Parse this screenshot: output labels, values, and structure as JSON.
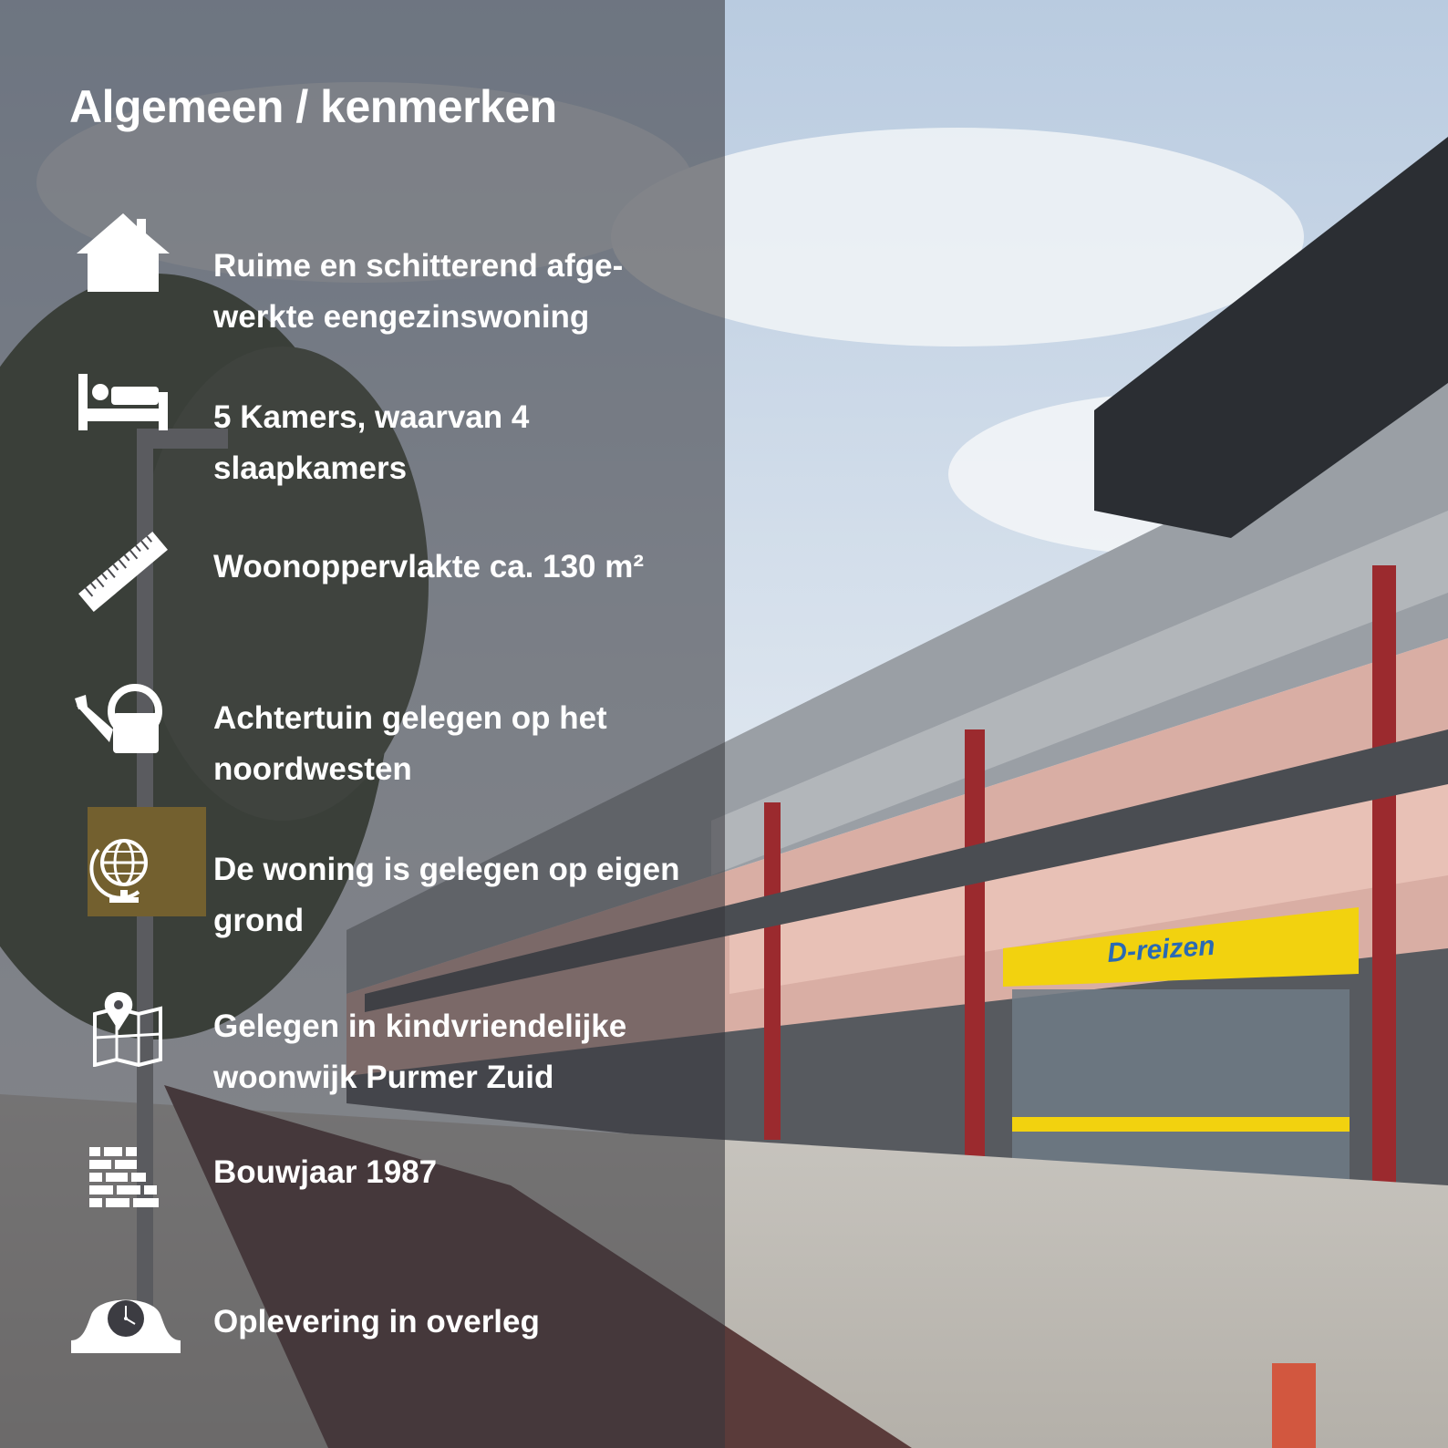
{
  "title": "Algemeen / kenmerken",
  "features": [
    {
      "icon": "house-icon",
      "text": "Ruime en schitterend afge-werkte eengezinswoning"
    },
    {
      "icon": "bed-icon",
      "text": "5 Kamers, waarvan 4 slaapkamers"
    },
    {
      "icon": "ruler-icon",
      "text": "Woonoppervlakte ca. 130 m²"
    },
    {
      "icon": "watering-can-icon",
      "text": "Achtertuin gelegen op het noordwesten"
    },
    {
      "icon": "globe-icon",
      "text": "De woning is gelegen op eigen grond"
    },
    {
      "icon": "map-pin-icon",
      "text": "Gelegen in kindvriendelijke woonwijk Purmer Zuid"
    },
    {
      "icon": "bricks-icon",
      "text": "Bouwjaar 1987"
    },
    {
      "icon": "mantel-clock-icon",
      "text": "Oplevering in overleg"
    }
  ],
  "storefront_sign": "D-reizen",
  "colors": {
    "panel_overlay": "#37373c",
    "text": "#ffffff",
    "sign_yellow": "#f2d20f",
    "sign_text": "#2a6ab4"
  }
}
